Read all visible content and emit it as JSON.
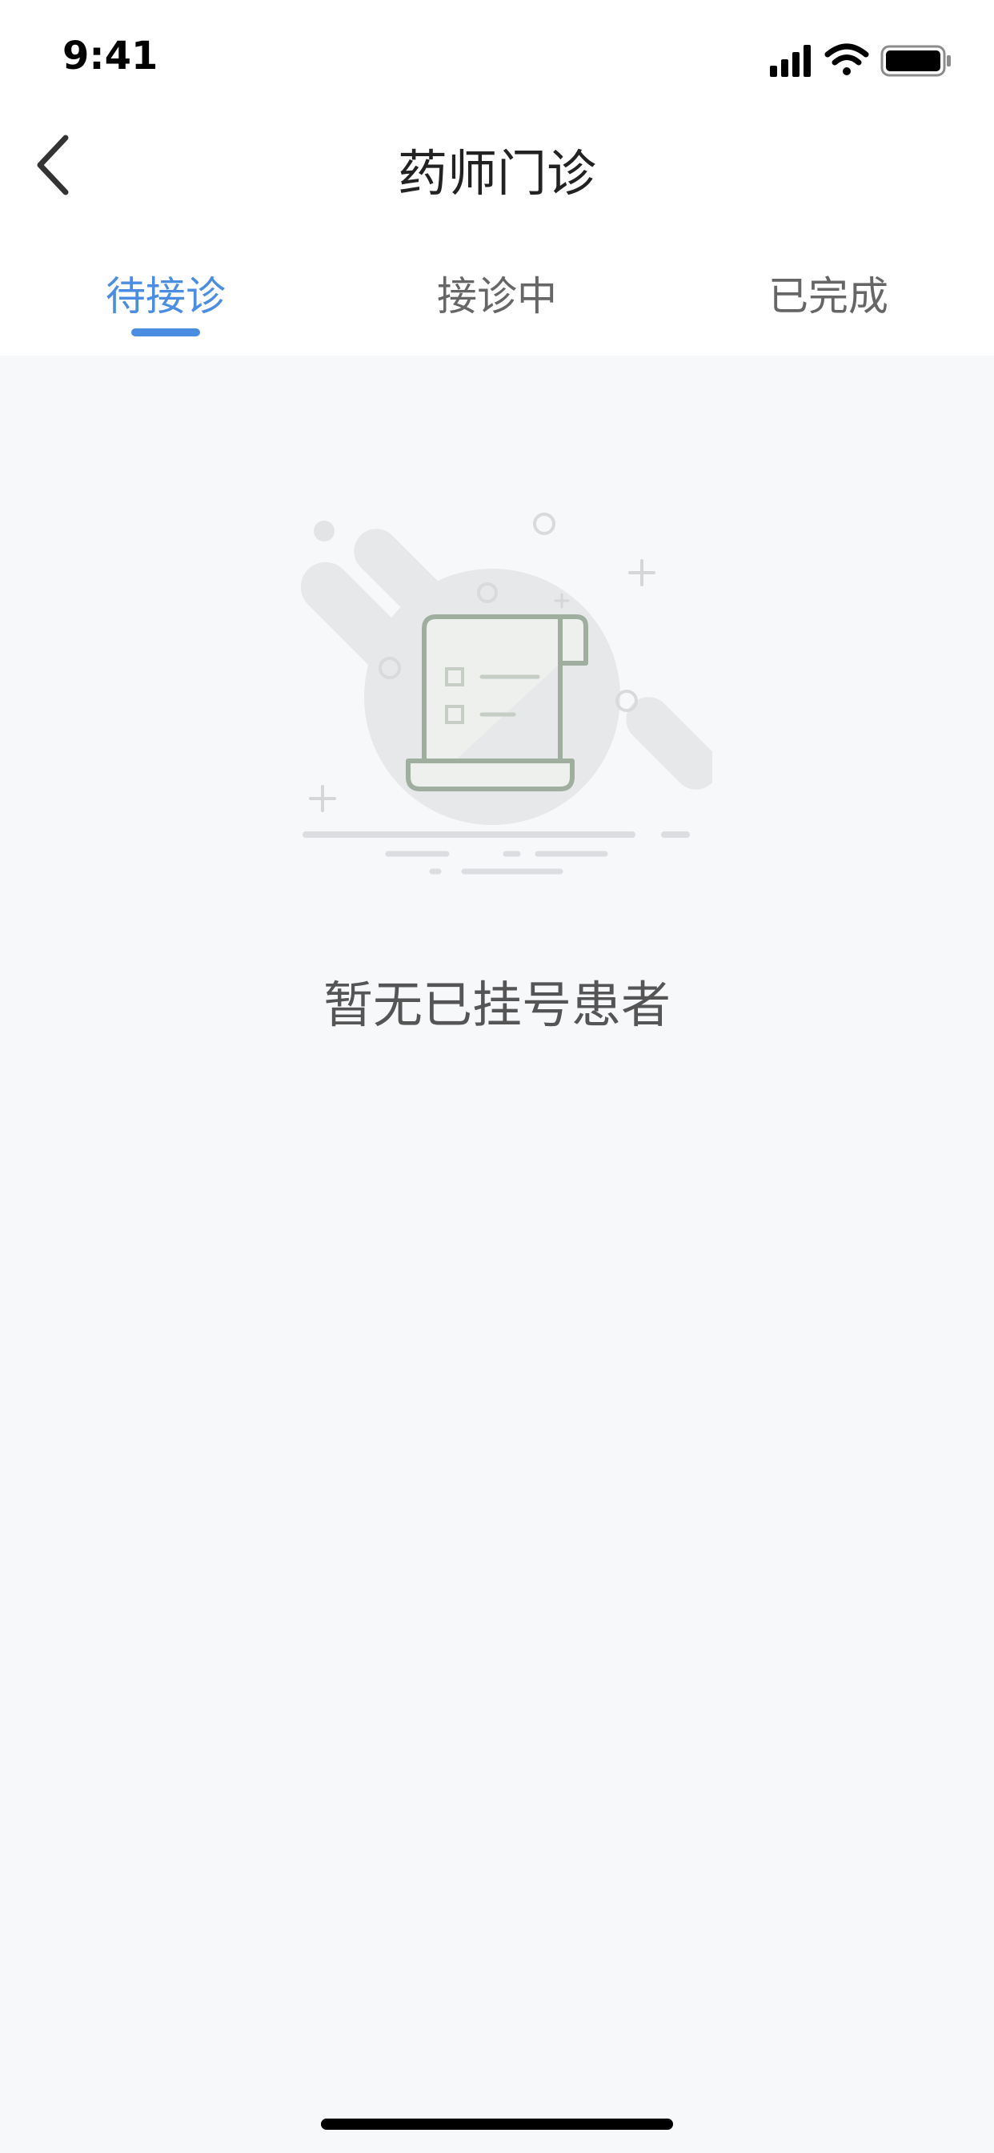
{
  "status_bar": {
    "time": "9:41"
  },
  "header": {
    "title": "药师门诊"
  },
  "tabs": [
    {
      "label": "待接诊",
      "active": true
    },
    {
      "label": "接诊中",
      "active": false
    },
    {
      "label": "已完成",
      "active": false
    }
  ],
  "empty_state": {
    "message": "暂无已挂号患者",
    "icon": "scroll-list-icon"
  },
  "colors": {
    "accent": "#4a8de3",
    "background": "#f7f8fa"
  }
}
